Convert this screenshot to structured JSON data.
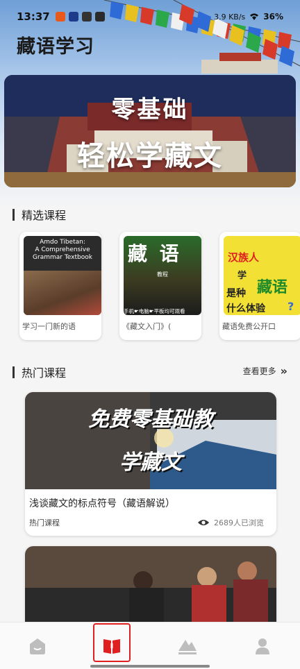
{
  "status": {
    "time": "13:37",
    "net_speed": "3.9 KB/s",
    "battery": "36%"
  },
  "app": {
    "title": "藏语学习"
  },
  "banner": {
    "line1": "零基础",
    "line2": "轻松学藏文"
  },
  "featured": {
    "title": "精选课程",
    "cards": [
      {
        "label": "学习一门新的语",
        "cover_text": [
          "Amdo Tibetan:",
          "A Comprehensive",
          "Grammar Textbook"
        ]
      },
      {
        "label": "《藏文入门》(",
        "cover_text": [
          "藏 语",
          "教程",
          "手机☛电脑☛平板均可观看"
        ]
      },
      {
        "label": "藏语免费公开口",
        "cover_text": [
          "汉族人",
          "学",
          "藏语",
          "是种",
          "什么体验",
          "?"
        ]
      }
    ]
  },
  "popular": {
    "title": "热门课程",
    "see_more": "查看更多",
    "courses": [
      {
        "title": "浅谈藏文的标点符号（藏语解说）",
        "tag": "热门课程",
        "views": "2689人已浏览",
        "cover_text": [
          "免费零基础教",
          "学藏文"
        ]
      },
      {
        "title": "",
        "tag": "",
        "views": "",
        "cover_text": []
      }
    ]
  },
  "nav": {
    "items": [
      "home-icon",
      "book-icon",
      "mountain-icon",
      "person-icon"
    ],
    "active_index": 1
  },
  "colors": {
    "accent_red": "#e02020",
    "nav_icon": "#bdbdbd"
  }
}
